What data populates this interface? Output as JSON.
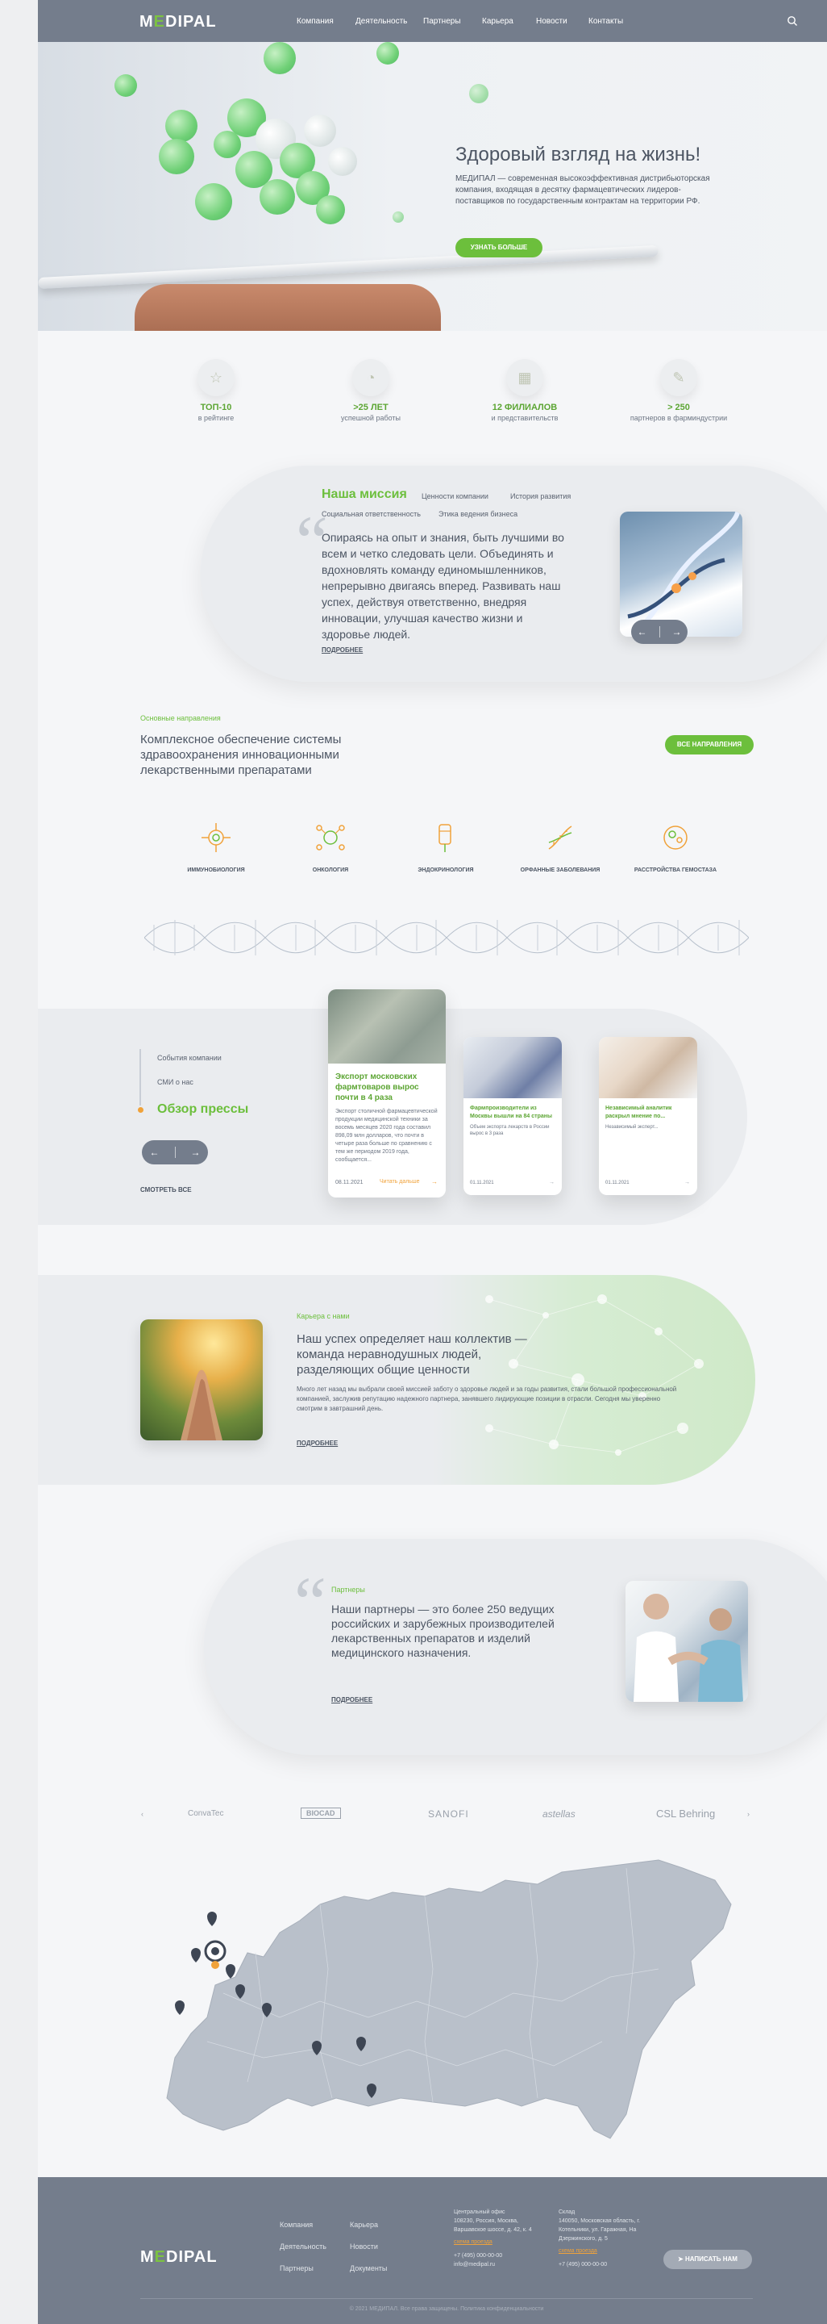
{
  "header": {
    "logo": {
      "pre": "M",
      "e": "E",
      "post": "DIPAL"
    },
    "nav": [
      "Компания",
      "Деятельность",
      "Партнеры",
      "Карьера",
      "Новости",
      "Контакты"
    ]
  },
  "hero": {
    "title": "Здоровый взгляд на жизнь!",
    "text": "МЕДИПАЛ — современная высокоэффективная дистрибьюторская компания, входящая в десятку фармацевтических лидеров-поставщиков по государственным контрактам на территории РФ.",
    "button": "Узнать больше"
  },
  "stats": [
    {
      "value": "ТОП-10",
      "label": "в рейтинге",
      "icon": "star-icon"
    },
    {
      "value": ">25 ЛЕТ",
      "label": "успешной работы",
      "icon": "clock-icon"
    },
    {
      "value": "12 ФИЛИАЛОВ",
      "label": "и представительств",
      "icon": "building-icon"
    },
    {
      "value": "> 250",
      "label": "партнеров в фарминдустрии",
      "icon": "handshake-icon"
    }
  ],
  "mission": {
    "tabs": [
      "Наша миссия",
      "Ценности компании",
      "История развития",
      "Социальная ответственность",
      "Этика ведения бизнеса"
    ],
    "text": "Опираясь на опыт и знания, быть лучшими во всем и четко следовать цели. Объединять и вдохновлять команду единомышленников, непрерывно двигаясь вперед. Развивать наш успех, действуя ответственно, внедряя инновации, улучшая качество жизни и здоровье людей.",
    "more": "подробнее",
    "prev": "←",
    "next": "→"
  },
  "directions": {
    "subtitle": "Основные направления",
    "title": "Комплексное обеспечение системы здравоохранения инновационными лекарственными препаратами",
    "button": "Все направления",
    "items": [
      {
        "label": "Иммунобиология",
        "icon": "immunology-icon"
      },
      {
        "label": "Онкология",
        "icon": "oncology-icon"
      },
      {
        "label": "Эндокринология",
        "icon": "endocrinology-icon"
      },
      {
        "label": "Орфанные заболевания",
        "icon": "orphan-icon"
      },
      {
        "label": "Расстройства гемостаза",
        "icon": "hemostasis-icon"
      }
    ]
  },
  "news": {
    "nav": [
      "События компании",
      "СМИ о нас",
      "Обзор прессы"
    ],
    "see_all": "Смотреть все",
    "prev": "←",
    "next": "→",
    "cards": [
      {
        "title": "Экспорт московских фармтоваров вырос почти в 4 раза",
        "text": "Экспорт столичной фармацевтической продукции медицинской техники за восемь месяцев 2020 года составил 898,09 млн долларов, что почти в четыре раза больше по сравнению с тем же периодом 2019 года, сообщается...",
        "date": "08.11.2021",
        "more": "Читать дальше"
      },
      {
        "title": "Фармпроизводители из Москвы вышли на 84 страны",
        "text": "Объем экспорта лекарств в России вырос в 3 раза",
        "date": "08.11.2021",
        "more": ""
      },
      {
        "title": "Независимый аналитик раскрыл мнение по...",
        "text": "Независимый эксперт...",
        "date": "01.11.2021",
        "more": ""
      }
    ]
  },
  "team": {
    "subtitle": "Карьера с нами",
    "title": "Наш успех определяет наш коллектив — команда неравнодушных людей, разделяющих общие ценности",
    "text": "Много лет назад мы выбрали своей миссией заботу о здоровье людей и за годы развития, стали большой профессиональной компанией, заслужив репутацию надежного партнера, занявшего лидирующие позиции в отрасли. Сегодня мы уверенно смотрим в завтрашний день.",
    "more": "подробнее"
  },
  "partners": {
    "subtitle": "Партнеры",
    "title": "Наши партнеры — это более 250 ведущих российских и зарубежных производителей лекарственных препаратов и изделий медицинского назначения.",
    "more": "подробнее",
    "logos": [
      "ConvaTec",
      "BIOCAD",
      "SANOFI",
      "astellas",
      "CSL Behring"
    ]
  },
  "footer": {
    "links_col1": [
      "Компания",
      "Деятельность",
      "Партнеры"
    ],
    "links_col2": [
      "Карьера",
      "Новости",
      "Документы"
    ],
    "office": {
      "label": "Центральный офис",
      "address": "108230, Россия, Москва, Варшавское шоссе, д. 42, к. 4",
      "map": "схема проезда",
      "phone": "+7 (495) 000-00-00",
      "email": "info@medipal.ru"
    },
    "warehouse": {
      "label": "Склад",
      "address": "140050, Московская область, г. Котельники, ул. Гаражная, На Дзержинского, д. 5",
      "map": "схема проезда",
      "phone": "+7 (495) 000-00-00"
    },
    "button": "Написать нам",
    "copyright": "© 2021 МЕДИПАЛ. Все права защищены. Политика конфиденциальности"
  }
}
